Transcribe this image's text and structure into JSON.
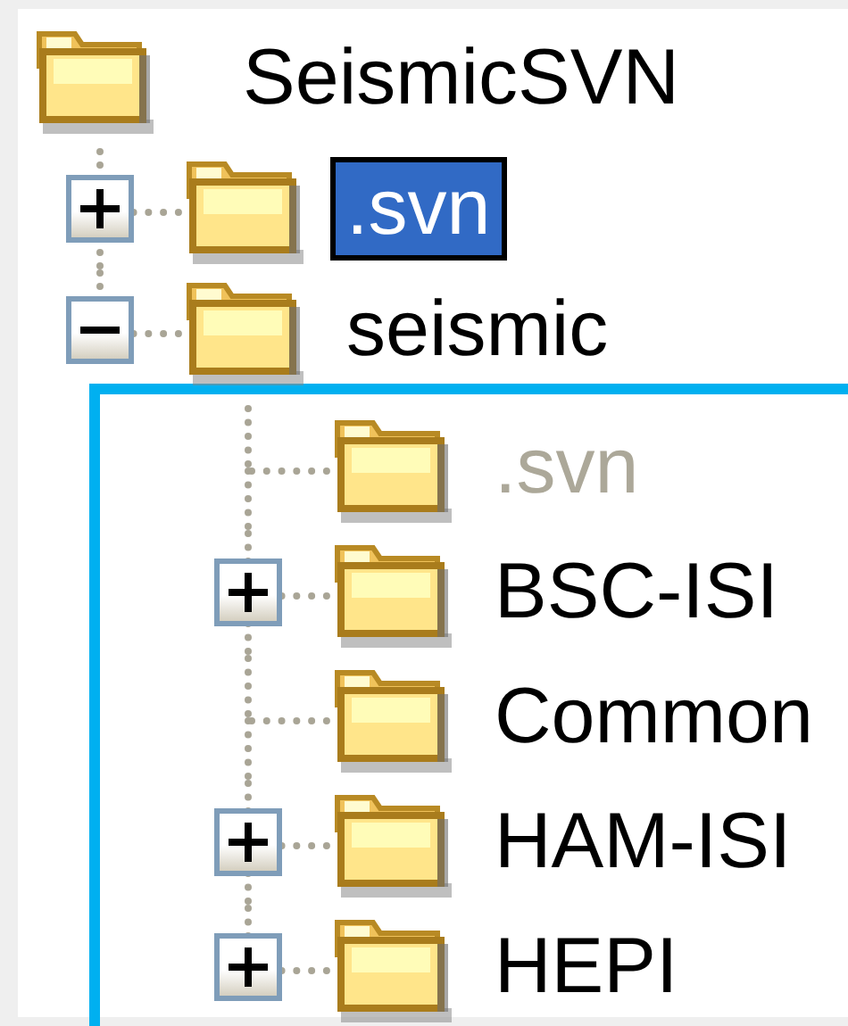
{
  "tree": {
    "root": {
      "label": "SeismicSVN",
      "children": [
        {
          "label": ".svn",
          "selected": true,
          "dimmed": false,
          "expanded": false
        },
        {
          "label": "seismic",
          "selected": false,
          "dimmed": false,
          "expanded": true,
          "highlighted": true,
          "children": [
            {
              "label": ".svn",
              "selected": false,
              "dimmed": true
            },
            {
              "label": "BSC-ISI",
              "selected": false,
              "dimmed": false,
              "expanded": false
            },
            {
              "label": "Common",
              "selected": false,
              "dimmed": false
            },
            {
              "label": "HAM-ISI",
              "selected": false,
              "dimmed": false,
              "expanded": false
            },
            {
              "label": "HEPI",
              "selected": false,
              "dimmed": false,
              "expanded": false
            }
          ]
        }
      ]
    }
  }
}
